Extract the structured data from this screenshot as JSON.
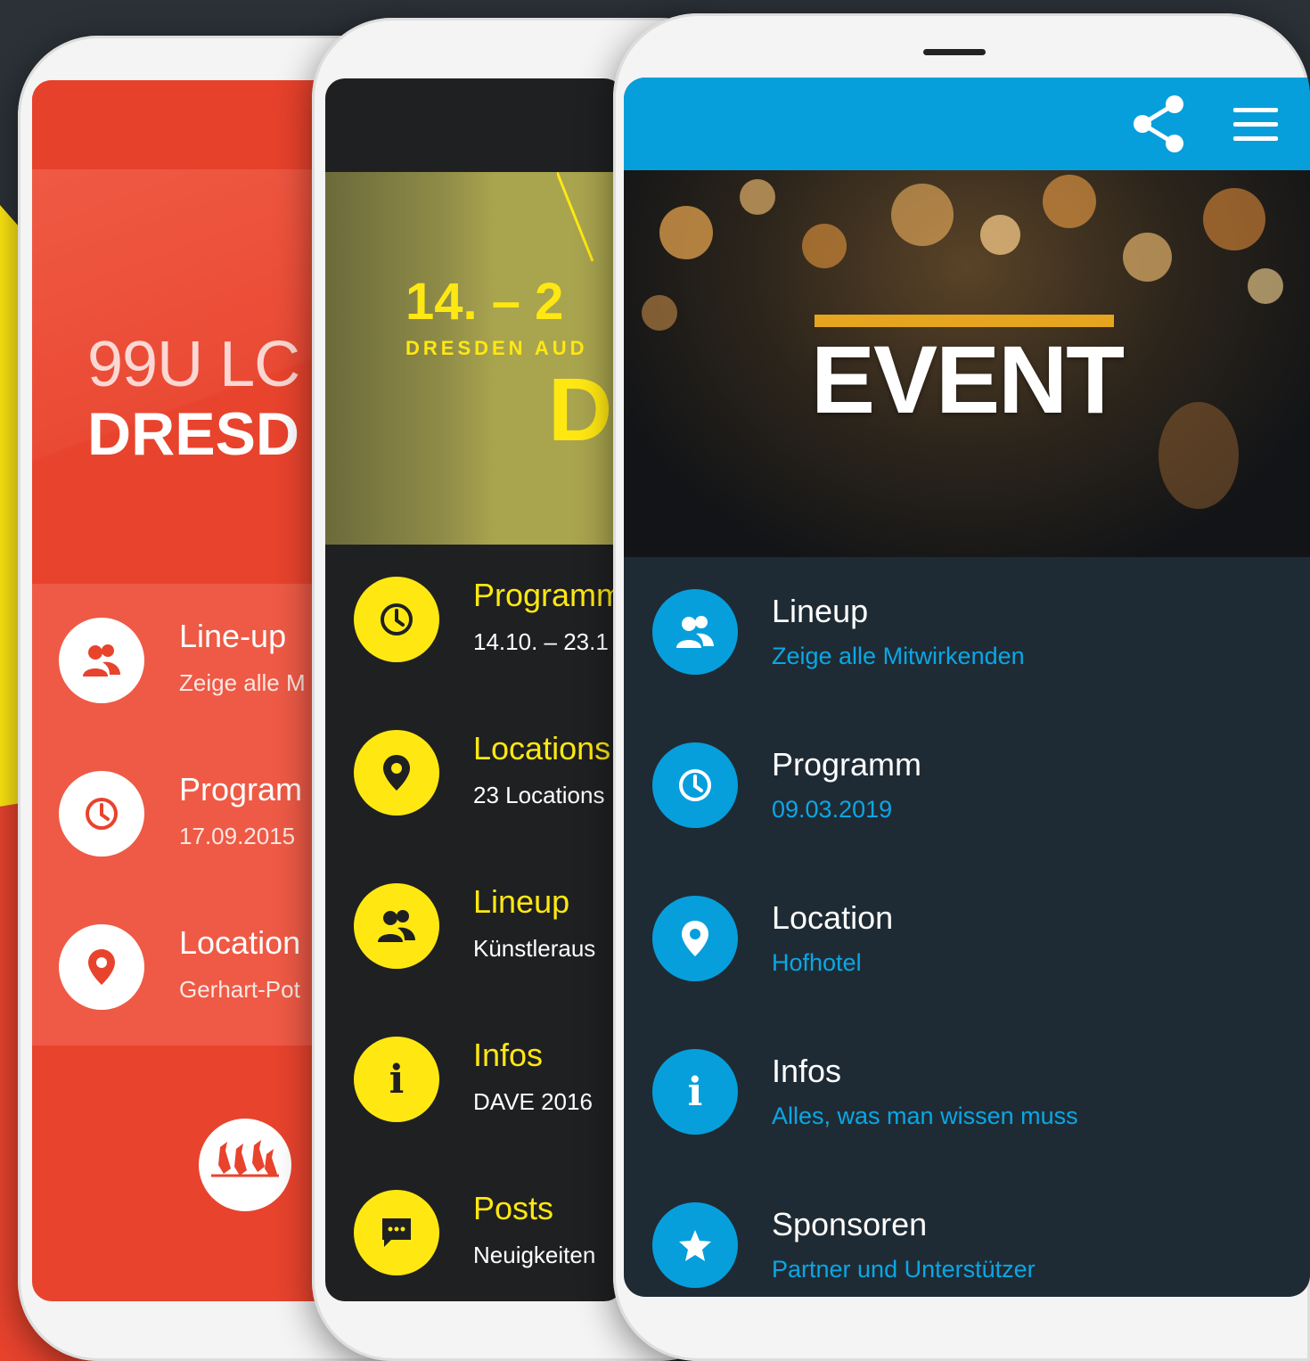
{
  "colors": {
    "red": "#e8432d",
    "yellow": "#ffe812",
    "blue": "#069fdc",
    "dark": "#1f2b34"
  },
  "phone1": {
    "title_line1": "99U LC",
    "title_line2": "DRESD",
    "items": [
      {
        "label": "Line-up",
        "sub": "Zeige alle M",
        "icon": "people-icon"
      },
      {
        "label": "Program",
        "sub": "17.09.2015",
        "icon": "clock-icon"
      },
      {
        "label": "Location",
        "sub": "Gerhart-Pot",
        "icon": "map-pin-icon"
      }
    ],
    "logo_icon": "birds-logo-icon"
  },
  "phone2": {
    "hero_date": "14. – 2",
    "hero_venue": "DRESDEN AUD",
    "hero_big": "D",
    "items": [
      {
        "label": "Programm",
        "sub": "14.10. – 23.1",
        "icon": "clock-icon"
      },
      {
        "label": "Locations",
        "sub": "23 Locations",
        "icon": "map-pin-icon"
      },
      {
        "label": "Lineup",
        "sub": "Künstleraus",
        "icon": "people-icon"
      },
      {
        "label": "Infos",
        "sub": "DAVE 2016",
        "icon": "info-icon"
      },
      {
        "label": "Posts",
        "sub": "Neuigkeiten",
        "icon": "chat-icon"
      }
    ]
  },
  "phone3": {
    "hero_title": "EVENT",
    "items": [
      {
        "label": "Lineup",
        "sub": "Zeige alle Mitwirkenden",
        "icon": "people-icon"
      },
      {
        "label": "Programm",
        "sub": "09.03.2019",
        "icon": "clock-icon"
      },
      {
        "label": "Location",
        "sub": "Hofhotel",
        "icon": "map-pin-icon"
      },
      {
        "label": "Infos",
        "sub": "Alles, was man wissen muss",
        "icon": "info-icon"
      },
      {
        "label": "Sponsoren",
        "sub": "Partner und Unterstützer",
        "icon": "star-icon"
      }
    ],
    "toolbar_icons": [
      "share-icon",
      "menu-icon"
    ]
  }
}
